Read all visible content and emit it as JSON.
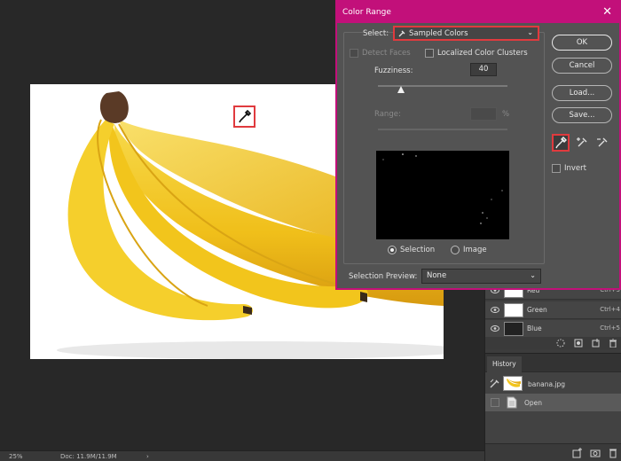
{
  "dialog": {
    "title": "Color Range",
    "close": "✕",
    "select_label": "Select:",
    "select_value": "Sampled Colors",
    "detect_faces": "Detect Faces",
    "localized_clusters": "Localized Color Clusters",
    "fuzziness_label": "Fuzziness:",
    "fuzziness_value": "40",
    "fuzziness_fraction": 0.18,
    "range_label": "Range:",
    "range_unit": "%",
    "selection_label": "Selection",
    "image_label": "Image",
    "selection_preview_label": "Selection Preview:",
    "selection_preview_value": "None",
    "ok": "OK",
    "cancel": "Cancel",
    "load": "Load...",
    "save": "Save...",
    "invert": "Invert"
  },
  "channels": [
    {
      "name": "Red",
      "key": "Ctrl+3"
    },
    {
      "name": "Green",
      "key": "Ctrl+4"
    },
    {
      "name": "Blue",
      "key": "Ctrl+5"
    }
  ],
  "history": {
    "tab": "History",
    "snapshot": "banana.jpg",
    "step": "Open"
  },
  "status": {
    "zoom": "25%",
    "doc": "Doc: 11.9M/11.9M",
    "arrow": "›"
  },
  "colors": {
    "accent": "#c2107a",
    "highlight": "#e03a3e",
    "banana": "#f2c51c"
  }
}
